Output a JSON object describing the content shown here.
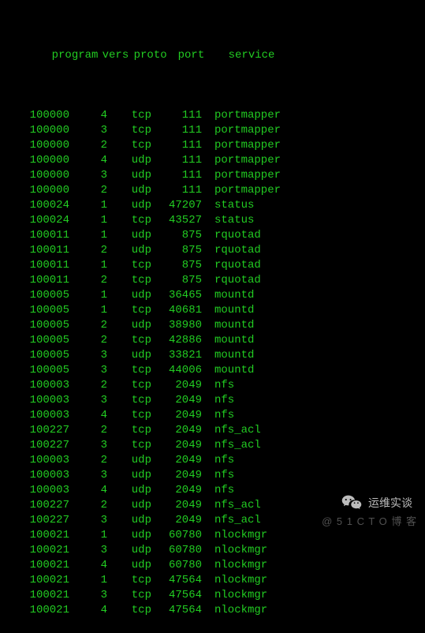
{
  "header": {
    "program": "program",
    "vers": "vers",
    "proto": "proto",
    "port": "port",
    "service": "service"
  },
  "rows": [
    {
      "program": "100000",
      "vers": "4",
      "proto": "tcp",
      "port": "111",
      "service": "portmapper"
    },
    {
      "program": "100000",
      "vers": "3",
      "proto": "tcp",
      "port": "111",
      "service": "portmapper"
    },
    {
      "program": "100000",
      "vers": "2",
      "proto": "tcp",
      "port": "111",
      "service": "portmapper"
    },
    {
      "program": "100000",
      "vers": "4",
      "proto": "udp",
      "port": "111",
      "service": "portmapper"
    },
    {
      "program": "100000",
      "vers": "3",
      "proto": "udp",
      "port": "111",
      "service": "portmapper"
    },
    {
      "program": "100000",
      "vers": "2",
      "proto": "udp",
      "port": "111",
      "service": "portmapper"
    },
    {
      "program": "100024",
      "vers": "1",
      "proto": "udp",
      "port": "47207",
      "service": "status"
    },
    {
      "program": "100024",
      "vers": "1",
      "proto": "tcp",
      "port": "43527",
      "service": "status"
    },
    {
      "program": "100011",
      "vers": "1",
      "proto": "udp",
      "port": "875",
      "service": "rquotad"
    },
    {
      "program": "100011",
      "vers": "2",
      "proto": "udp",
      "port": "875",
      "service": "rquotad"
    },
    {
      "program": "100011",
      "vers": "1",
      "proto": "tcp",
      "port": "875",
      "service": "rquotad"
    },
    {
      "program": "100011",
      "vers": "2",
      "proto": "tcp",
      "port": "875",
      "service": "rquotad"
    },
    {
      "program": "100005",
      "vers": "1",
      "proto": "udp",
      "port": "36465",
      "service": "mountd"
    },
    {
      "program": "100005",
      "vers": "1",
      "proto": "tcp",
      "port": "40681",
      "service": "mountd"
    },
    {
      "program": "100005",
      "vers": "2",
      "proto": "udp",
      "port": "38980",
      "service": "mountd"
    },
    {
      "program": "100005",
      "vers": "2",
      "proto": "tcp",
      "port": "42886",
      "service": "mountd"
    },
    {
      "program": "100005",
      "vers": "3",
      "proto": "udp",
      "port": "33821",
      "service": "mountd"
    },
    {
      "program": "100005",
      "vers": "3",
      "proto": "tcp",
      "port": "44006",
      "service": "mountd"
    },
    {
      "program": "100003",
      "vers": "2",
      "proto": "tcp",
      "port": "2049",
      "service": "nfs"
    },
    {
      "program": "100003",
      "vers": "3",
      "proto": "tcp",
      "port": "2049",
      "service": "nfs"
    },
    {
      "program": "100003",
      "vers": "4",
      "proto": "tcp",
      "port": "2049",
      "service": "nfs"
    },
    {
      "program": "100227",
      "vers": "2",
      "proto": "tcp",
      "port": "2049",
      "service": "nfs_acl"
    },
    {
      "program": "100227",
      "vers": "3",
      "proto": "tcp",
      "port": "2049",
      "service": "nfs_acl"
    },
    {
      "program": "100003",
      "vers": "2",
      "proto": "udp",
      "port": "2049",
      "service": "nfs"
    },
    {
      "program": "100003",
      "vers": "3",
      "proto": "udp",
      "port": "2049",
      "service": "nfs"
    },
    {
      "program": "100003",
      "vers": "4",
      "proto": "udp",
      "port": "2049",
      "service": "nfs"
    },
    {
      "program": "100227",
      "vers": "2",
      "proto": "udp",
      "port": "2049",
      "service": "nfs_acl"
    },
    {
      "program": "100227",
      "vers": "3",
      "proto": "udp",
      "port": "2049",
      "service": "nfs_acl"
    },
    {
      "program": "100021",
      "vers": "1",
      "proto": "udp",
      "port": "60780",
      "service": "nlockmgr"
    },
    {
      "program": "100021",
      "vers": "3",
      "proto": "udp",
      "port": "60780",
      "service": "nlockmgr"
    },
    {
      "program": "100021",
      "vers": "4",
      "proto": "udp",
      "port": "60780",
      "service": "nlockmgr"
    },
    {
      "program": "100021",
      "vers": "1",
      "proto": "tcp",
      "port": "47564",
      "service": "nlockmgr"
    },
    {
      "program": "100021",
      "vers": "3",
      "proto": "tcp",
      "port": "47564",
      "service": "nlockmgr"
    },
    {
      "program": "100021",
      "vers": "4",
      "proto": "tcp",
      "port": "47564",
      "service": "nlockmgr"
    }
  ],
  "watermark": {
    "label": "运维实谈",
    "corner": "@ 5 1 C T O 博 客"
  }
}
